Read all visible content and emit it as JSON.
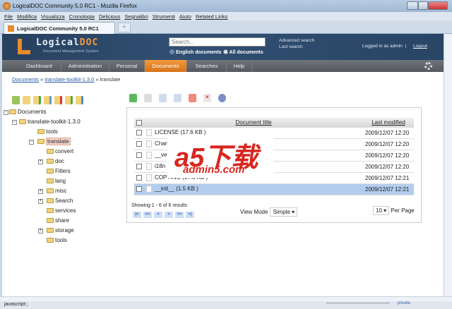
{
  "window": {
    "title": "LogicalDOC Community 5.0 RC1 - Mozilla Firefox"
  },
  "menu": [
    "File",
    "Modifica",
    "Visualizza",
    "Cronologia",
    "Delicious",
    "Segnalibri",
    "Strumenti",
    "Aiuto",
    "Related Links"
  ],
  "tab": {
    "label": "LogicalDOC Community 5.0 RC1",
    "new_tab": "+"
  },
  "header": {
    "logo_a": "Logical",
    "logo_b": "DOC",
    "logo_sub": "Document Management System",
    "search_placeholder": "Search...",
    "radio_english": "English documents",
    "radio_all": "All documents",
    "advanced": "Advanced search",
    "last": "Last search",
    "logged": "Logged in as admin",
    "sep": "|",
    "logout": "Logout"
  },
  "nav": [
    "Dashboard",
    "Administration",
    "Personal",
    "Documents",
    "Searches",
    "Help"
  ],
  "breadcrumb": {
    "a": "Documents",
    "b": "translate-toolkit-1.3.0",
    "c": "translate",
    "sep": "»"
  },
  "tree": {
    "root": "Documents",
    "toolkit": "translate-toolkit-1.3.0",
    "tools": "tools",
    "translate": "translate",
    "children": [
      "convert",
      "doc",
      "Filters",
      "lang",
      "misc",
      "Search",
      "services",
      "share",
      "storage",
      "tools"
    ]
  },
  "table": {
    "col_title": "Document title",
    "col_modified": "Last modified",
    "rows": [
      {
        "title": "LICENSE  (17.6 KB )",
        "date": "2009/12/07 12:20"
      },
      {
        "title": "ChangeLog",
        "date": "2009/12/07 12:20"
      },
      {
        "title": "__version__",
        "date": "2009/12/07 12:20"
      },
      {
        "title": "i18n  (9",
        "date": "2009/12/07 12:20"
      },
      {
        "title": "COPYING  (17.6 KB )",
        "date": "2009/12/07 12:21"
      },
      {
        "title": "__init__  (1.5 KB )",
        "date": "2009/12/07 12:21"
      }
    ]
  },
  "pager": {
    "showing": "Showing 1 - 6 of 6 results",
    "buttons": [
      "|<",
      "<<",
      "<",
      ">",
      ">>",
      ">|"
    ],
    "view_mode_label": "View Mode",
    "view_mode": "Simple",
    "per_page": "10",
    "per_page_label": "Per Page"
  },
  "status": {
    "text": "javascript:;",
    "private": "private"
  },
  "watermark": {
    "a": "a5下载",
    "b": "admin5.com"
  }
}
